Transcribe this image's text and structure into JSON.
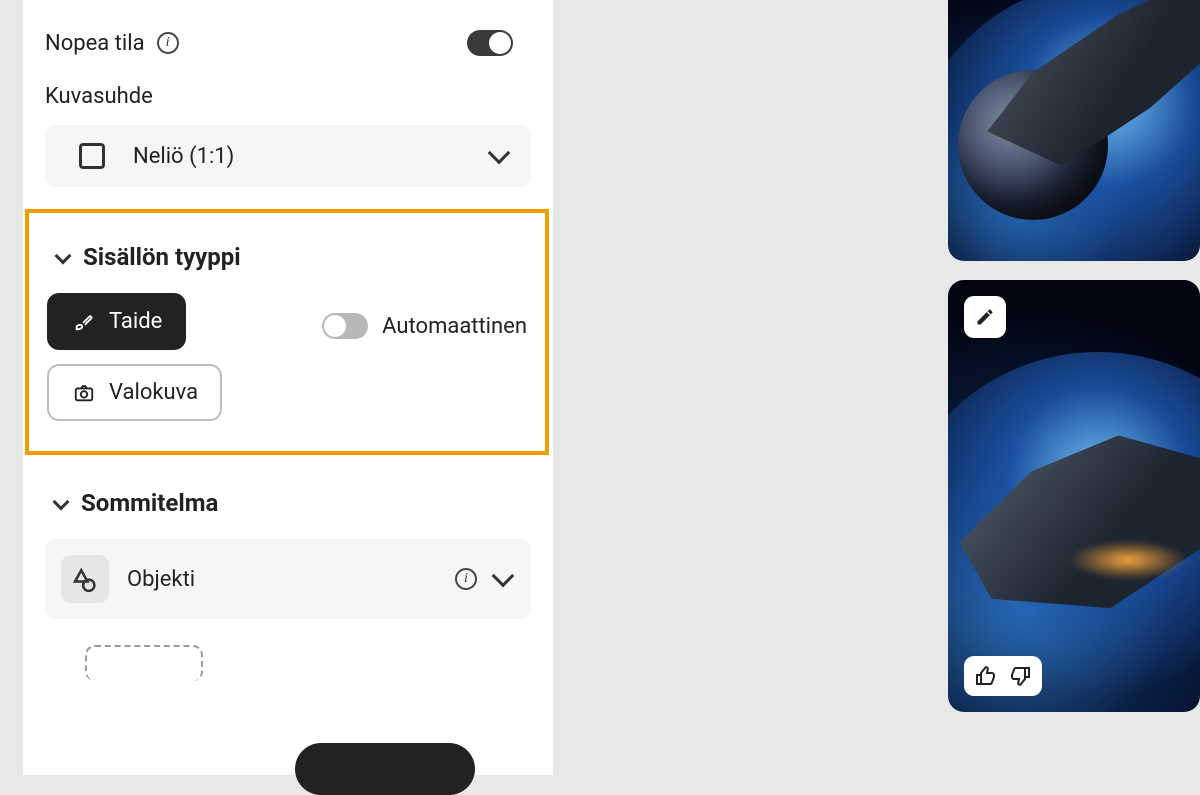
{
  "fastmode": {
    "label": "Nopea tila",
    "enabled": true
  },
  "aspect": {
    "section_label": "Kuvasuhde",
    "selected": "Neliö (1:1)"
  },
  "content_type": {
    "header": "Sisällön tyyppi",
    "art_label": "Taide",
    "photo_label": "Valokuva",
    "auto_label": "Automaattinen",
    "auto_enabled": false
  },
  "composition": {
    "header": "Sommitelma",
    "object_label": "Objekti"
  }
}
